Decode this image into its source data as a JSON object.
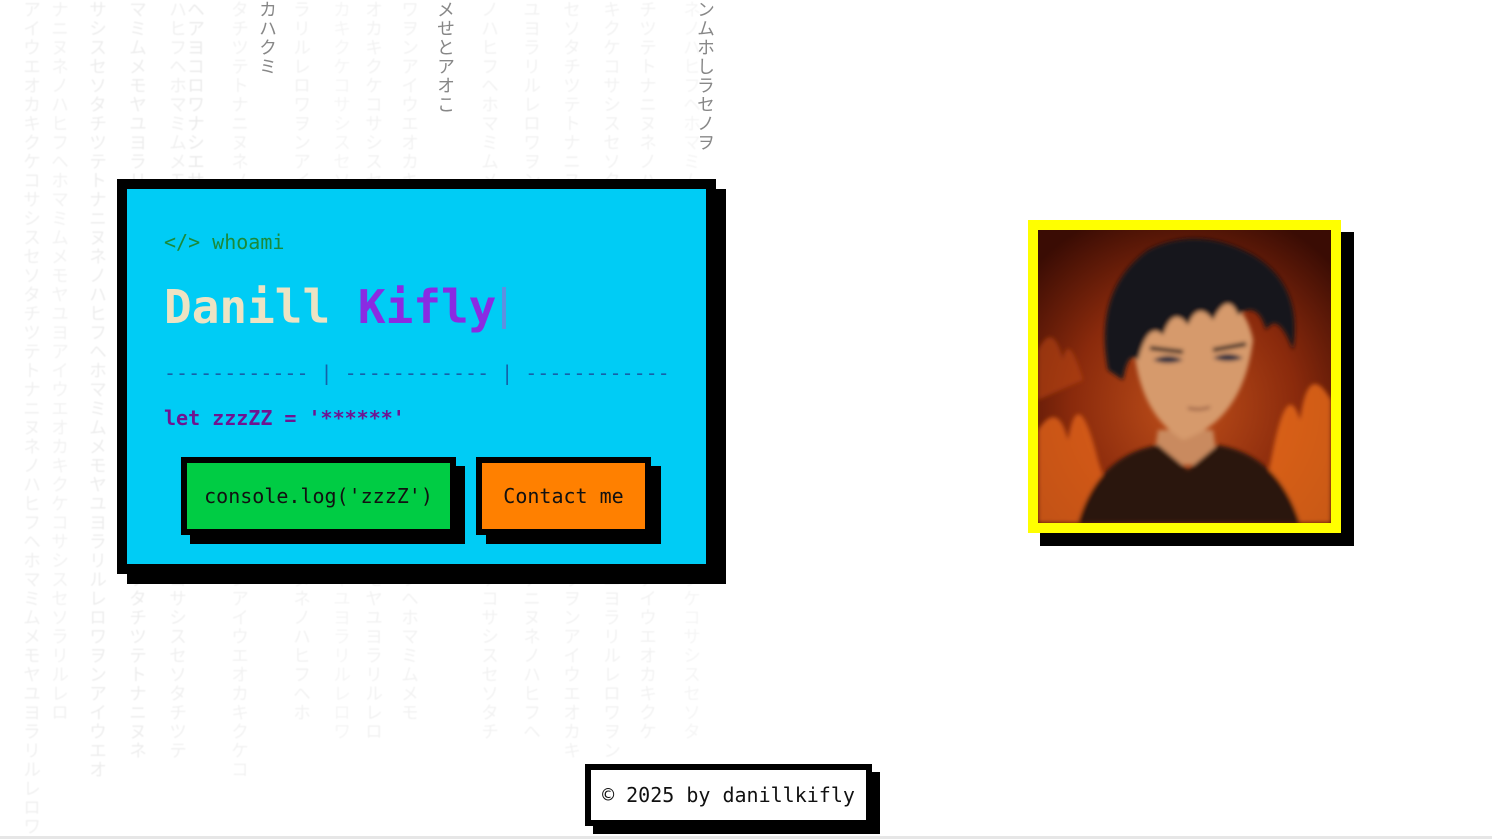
{
  "hero": {
    "prompt": "</> whoami",
    "first_name": "Danill",
    "last_name": "Kifly",
    "divider": "------------ | ------------ | ------------",
    "code_line": "let zzzZZ = '******'"
  },
  "buttons": {
    "console_label": "console.log('zzzZ')",
    "contact_label": "Contact me"
  },
  "footer": {
    "text": "© 2025 by danillkifly"
  },
  "background": {
    "rain_columns": [
      "カハクミ",
      "メせとアオこ",
      "ンムホしラセノヲ"
    ]
  },
  "colors": {
    "card_bg": "#00ccf5",
    "first_name": "#ede3c3",
    "last_name": "#8a2be2",
    "console_button": "#00cc44",
    "contact_button": "#ff8000",
    "avatar_frame": "#ffff00"
  }
}
